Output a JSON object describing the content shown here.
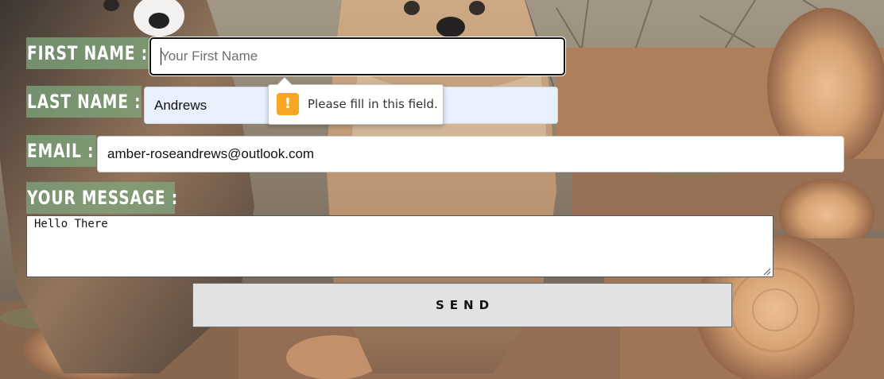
{
  "form": {
    "first_name_label": "FIRST NAME :",
    "first_name_placeholder": "Your First Name",
    "first_name_value": "",
    "last_name_label": "LAST NAME :",
    "last_name_value": "Andrews",
    "email_label": "EMAIL :",
    "email_value": "amber-roseandrews@outlook.com",
    "message_label": "YOUR MESSAGE :",
    "message_value": "Hello There",
    "send_label": "SEND"
  },
  "validation": {
    "message": "Please fill in this field.",
    "icon": "warning-icon",
    "icon_glyph": "!",
    "icon_color": "#f6a623"
  },
  "colors": {
    "label_background": "#7eaa80",
    "label_text": "#ffffff",
    "autofill_background": "#e8f0fe",
    "button_background": "#e2e2e2"
  }
}
